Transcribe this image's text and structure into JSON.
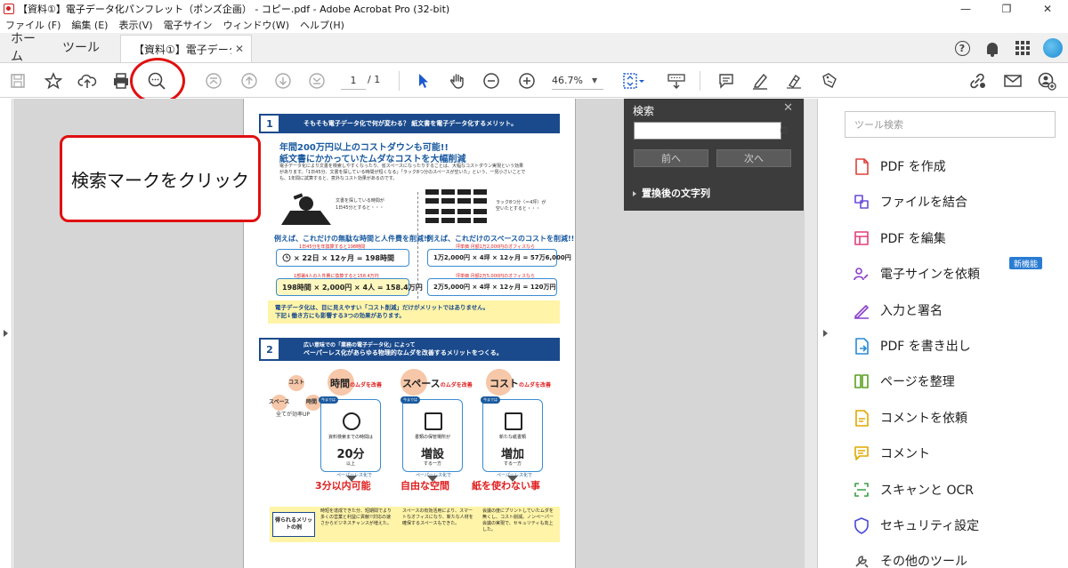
{
  "window": {
    "title": "【資料①】電子データ化パンフレット（ポンズ企画） - コピー.pdf - Adobe Acrobat Pro (32-bit)"
  },
  "menu": [
    "ファイル (F)",
    "編集 (E)",
    "表示(V)",
    "電子サイン",
    "ウィンドウ(W)",
    "ヘルプ(H)"
  ],
  "tabs": {
    "home": "ホーム",
    "tools": "ツール",
    "doc": "【資料①】電子データ..."
  },
  "toolbar": {
    "page_current": "1",
    "page_total": "/ 1",
    "zoom": "46.7%"
  },
  "callout": {
    "text": "検索マークをクリック"
  },
  "search_panel": {
    "title": "検索",
    "input_value": "",
    "prev_label": "前へ",
    "next_label": "次へ",
    "replace_label": "置換後の文字列"
  },
  "right_panel": {
    "search_placeholder": "ツール検索",
    "new_badge": "新機能",
    "items": [
      {
        "label": "PDF を作成",
        "icon": "create-pdf-icon",
        "color": "#e0403a"
      },
      {
        "label": "ファイルを結合",
        "icon": "combine-files-icon",
        "color": "#6a4ad8"
      },
      {
        "label": "PDF を編集",
        "icon": "edit-pdf-icon",
        "color": "#e0407a"
      },
      {
        "label": "電子サインを依頼",
        "icon": "request-esign-icon",
        "color": "#8a40c8"
      },
      {
        "label": "入力と署名",
        "icon": "fill-sign-icon",
        "color": "#8a40c8"
      },
      {
        "label": "PDF を書き出し",
        "icon": "export-pdf-icon",
        "color": "#2a8ad4"
      },
      {
        "label": "ページを整理",
        "icon": "organize-pages-icon",
        "color": "#5aa020"
      },
      {
        "label": "コメントを依頼",
        "icon": "request-comment-icon",
        "color": "#e0a800"
      },
      {
        "label": "コメント",
        "icon": "comment-icon",
        "color": "#e0a800"
      },
      {
        "label": "スキャンと OCR",
        "icon": "scan-ocr-icon",
        "color": "#3aa040"
      },
      {
        "label": "セキュリティ設定",
        "icon": "security-icon",
        "color": "#4a4ad8"
      },
      {
        "label": "その他のツール",
        "icon": "more-tools-icon",
        "color": "#555555"
      }
    ]
  },
  "doc": {
    "sec1_num": "1",
    "sec1_title": "そもそも電子データ化で何が変わる？ 紙文書を電子データ化するメリット。",
    "h1": "年間200万円以上のコストダウンも可能!!",
    "h2": "紙文書にかかっていたムダなコストを大幅削減",
    "intro1": "電子データ化により文書を検索しやすくなったり、省スペースになったりすることは、大幅なコストダウン実現という効果",
    "intro2": "があります。「1日45分、文書を探している時間が短くなる」「ラック8つ分のスペースが空いた」という、一見小さいことで",
    "intro3": "も、1年間に試算すると、意外なコスト効果があるのです。",
    "left_note1": "文書を探している時間が",
    "left_note2": "1日45分とすると・・・",
    "right_note1": "ラック8つ分（＝4坪）が",
    "right_note2": "空いたとすると・・・",
    "left_red": "例えば、これだけの無駄な時間と人件費を削減!!",
    "right_red": "例えば、これだけのスペースのコストを削減!!",
    "left_mini1": "1日45分を年換算すると198時間",
    "left_calc1": "× 22日 × 12ヶ月 = 198時間",
    "left_mini2": "1部署4人の人件費に換算すると158.4万円",
    "left_calc2": "198時間 × 2,000円 × 4人 = 158.4万円",
    "right_mini1": "坪単価 月額1万2,000円のオフィスなら",
    "right_calc1": "1万2,000円 × 4坪 × 12ヶ月 = 57万6,000円",
    "right_mini2": "坪単価 月額2万5,000円のオフィスなら",
    "right_calc2": "2万5,000円 × 4坪 × 12ヶ月 = 120万円",
    "note_line1": "電子データ化は、目に見えやすい「コスト削減」だけがメリットではありません。",
    "note_line2": "下記↓働き方にも影響する3つの効果があります。",
    "sec2_num": "2",
    "sec2_title": "ペーパーレス化があらゆる物理的なムダを改善するメリットをつくる。",
    "sec2_sub": "広い意味での「業務の電子データ化」によって",
    "diagram_cost": "コスト",
    "diagram_space": "スペース",
    "diagram_time": "時間",
    "diagram_label": "全てが効率UP",
    "col1_head": "時間",
    "col2_head": "スペース",
    "col3_head": "コスト",
    "col_suffix": "のムダを改善",
    "col1_tag": "今までは",
    "col1_sub": "資料検索までの時間は",
    "col1_big": "20分",
    "col1_big_sub": "以上",
    "col2_sub": "書類の保管場所が",
    "col2_big": "増設",
    "col2_big_sub": "する一方",
    "col3_sub": "新たな紙書類",
    "col3_big": "増加",
    "col3_big_sub": "する一方",
    "result_sub": "ペーパーレス化で",
    "res1": "3分以内可能",
    "res2": "自由な空間",
    "res3": "紙を使わない事",
    "bottom_label": "得られるメリットの例",
    "b1": "時短を達成できた分、短期間でより多くの営業と利益に貢献!!対応の速さからビジネスチャンスが増えた。",
    "b2": "スペースの有効活用により、スマートなオフィスになり、新たな人材を確保するスペースもできた。",
    "b3": "会議の度にプリントしていたムダを無くし、コスト削減。ノンペーパー会議の実現で、セキュリティも向上した。"
  }
}
